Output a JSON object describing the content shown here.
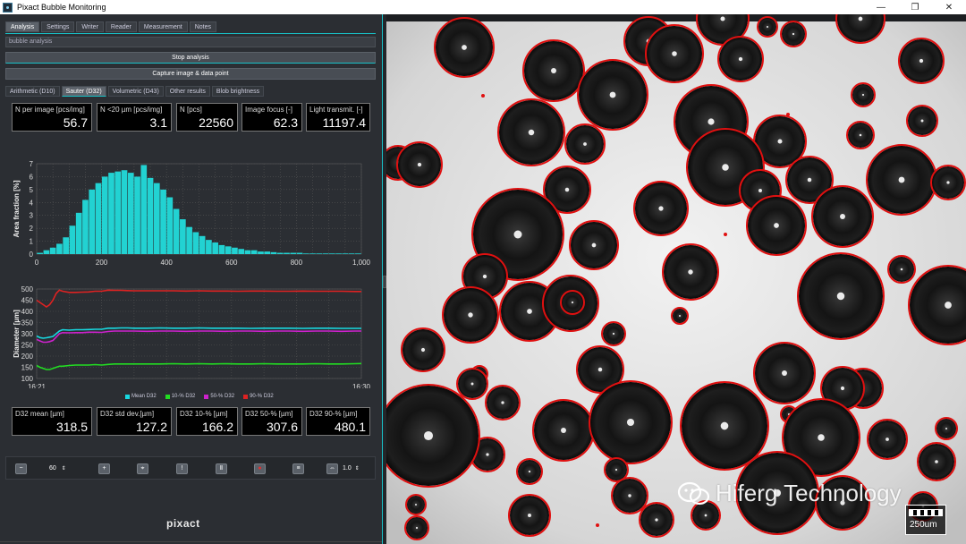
{
  "window": {
    "title": "Pixact Bubble Monitoring",
    "minimize": "—",
    "restore": "❐",
    "close": "✕"
  },
  "main_tabs": [
    "Analysis",
    "Settings",
    "Writer",
    "Reader",
    "Measurement",
    "Notes"
  ],
  "field_label": "bubble analysis",
  "buttons": {
    "stop": "Stop analysis",
    "capture": "Capture image & data point"
  },
  "sub_tabs": [
    "Arithmetic (D10)",
    "Sauter (D32)",
    "Volumetric (D43)",
    "Other results",
    "Blob brightness"
  ],
  "top_stats": [
    {
      "label": "N per image [pcs/img]",
      "value": "56.7"
    },
    {
      "label": "N <20 µm [pcs/img]",
      "value": "3.1"
    },
    {
      "label": "N [pcs]",
      "value": "22560"
    },
    {
      "label": "Image focus [-]",
      "value": "62.3"
    },
    {
      "label": "Light transmit. [-]",
      "value": "11197.4"
    }
  ],
  "bottom_stats": [
    {
      "label": "D32 mean [µm]",
      "value": "318.5"
    },
    {
      "label": "D32 std dev.[µm]",
      "value": "127.2"
    },
    {
      "label": "D32 10-% [µm]",
      "value": "166.2"
    },
    {
      "label": "D32 50-% [µm]",
      "value": "307.6"
    },
    {
      "label": "D32 90-% [µm]",
      "value": "480.1"
    }
  ],
  "toolbar": {
    "frame_value": "60",
    "zoom_value": "1.0"
  },
  "footer_logo": "pixact",
  "overlay": {
    "watermark": "Hiferg Technology",
    "scale_label": "250um"
  },
  "chart_data": [
    {
      "type": "bar",
      "xlabel": "Particle diameter [µm]",
      "ylabel": "Area fraction [%]",
      "xlim": [
        0,
        1000
      ],
      "ylim": [
        0,
        7
      ],
      "xticks": [
        "0",
        "200",
        "400",
        "600",
        "800",
        "1,000"
      ],
      "yticks": [
        "0",
        "1",
        "2",
        "3",
        "4",
        "5",
        "6",
        "7"
      ],
      "bin_width": 20,
      "bin_starts": [
        0,
        20,
        40,
        60,
        80,
        100,
        120,
        140,
        160,
        180,
        200,
        220,
        240,
        260,
        280,
        300,
        320,
        340,
        360,
        380,
        400,
        420,
        440,
        460,
        480,
        500,
        520,
        540,
        560,
        580,
        600,
        620,
        640,
        660,
        680,
        700,
        720,
        740,
        760,
        780,
        800,
        820,
        840,
        860,
        880,
        900,
        920,
        940,
        960,
        980
      ],
      "values": [
        0.1,
        0.3,
        0.5,
        0.8,
        1.3,
        2.2,
        3.2,
        4.2,
        5.0,
        5.5,
        6.0,
        6.3,
        6.4,
        6.5,
        6.3,
        6.0,
        6.9,
        5.9,
        5.5,
        5.0,
        4.4,
        3.5,
        2.7,
        2.1,
        1.7,
        1.4,
        1.1,
        0.9,
        0.7,
        0.6,
        0.5,
        0.4,
        0.3,
        0.3,
        0.2,
        0.2,
        0.15,
        0.1,
        0.1,
        0.1,
        0.1,
        0.05,
        0.05,
        0.05,
        0.05,
        0.05,
        0.05,
        0.05,
        0.05,
        0.05
      ]
    },
    {
      "type": "line",
      "xlabel": "Time",
      "ylabel": "Diameter [µm]",
      "ylim": [
        100,
        500
      ],
      "xticks": [
        "16:21",
        "16:30"
      ],
      "yticks": [
        "100",
        "150",
        "200",
        "250",
        "300",
        "350",
        "400",
        "450",
        "500"
      ],
      "x": [
        0,
        1,
        2,
        3,
        4,
        5,
        6,
        7,
        8,
        10,
        12,
        14,
        16,
        18,
        20,
        22,
        24,
        26,
        28,
        30,
        34,
        38,
        42,
        46,
        50,
        54,
        58,
        62,
        66,
        70,
        74,
        78,
        82,
        86,
        90,
        94,
        98,
        100
      ],
      "series": [
        {
          "name": "Mean D32",
          "color": "#18d8e0",
          "values": [
            290,
            283,
            280,
            282,
            285,
            288,
            300,
            312,
            318,
            316,
            318,
            318,
            319,
            320,
            320,
            325,
            325,
            326,
            326,
            325,
            325,
            326,
            325,
            325,
            326,
            325,
            325,
            325,
            324,
            325,
            325,
            325,
            324,
            325,
            325,
            324,
            324,
            324
          ]
        },
        {
          "name": "10-% D32",
          "color": "#22dd22",
          "values": [
            158,
            150,
            145,
            140,
            140,
            145,
            150,
            155,
            155,
            158,
            160,
            160,
            160,
            162,
            160,
            163,
            165,
            165,
            165,
            165,
            165,
            165,
            166,
            165,
            166,
            165,
            166,
            165,
            165,
            166,
            165,
            165,
            165,
            166,
            165,
            165,
            166,
            167
          ]
        },
        {
          "name": "50-% D32",
          "color": "#cc22cc",
          "values": [
            275,
            268,
            262,
            262,
            265,
            270,
            285,
            300,
            305,
            304,
            305,
            305,
            307,
            307,
            306,
            310,
            312,
            312,
            312,
            312,
            311,
            312,
            312,
            311,
            312,
            312,
            311,
            312,
            312,
            311,
            312,
            312,
            311,
            312,
            312,
            311,
            312,
            312
          ]
        },
        {
          "name": "90-% D32",
          "color": "#dd2222",
          "values": [
            450,
            440,
            430,
            420,
            430,
            450,
            480,
            495,
            490,
            485,
            485,
            486,
            487,
            490,
            490,
            495,
            494,
            494,
            493,
            492,
            492,
            492,
            492,
            491,
            492,
            491,
            491,
            490,
            491,
            491,
            490,
            490,
            491,
            490,
            490,
            490,
            489,
            489
          ]
        }
      ]
    }
  ]
}
